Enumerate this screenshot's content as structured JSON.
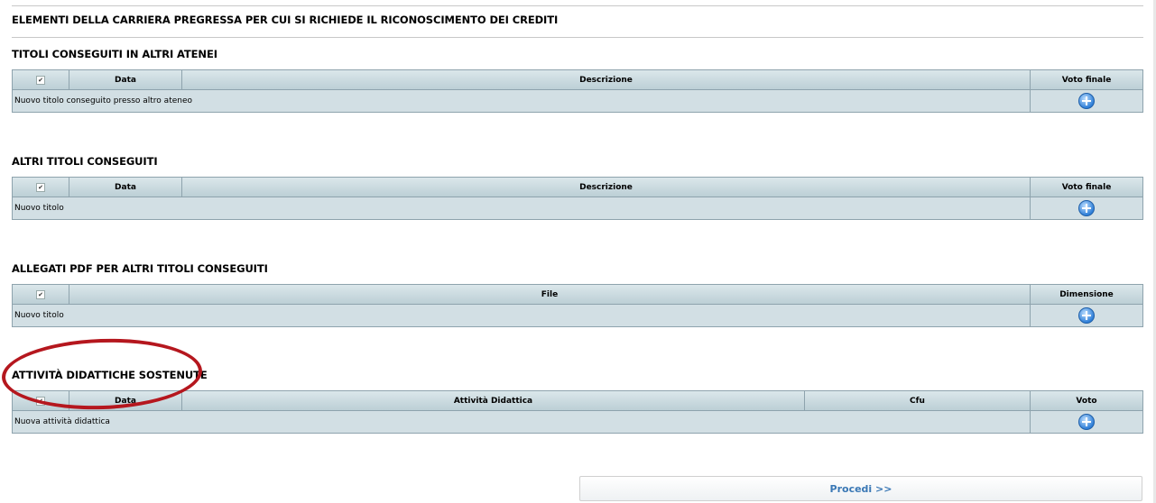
{
  "page_title": "ELEMENTI DELLA CARRIERA PREGRESSA PER CUI SI RICHIEDE IL RICONOSCIMENTO DEI CREDITI",
  "sections": [
    {
      "title": "TITOLI CONSEGUITI IN ALTRI ATENEI",
      "headers": [
        "✔",
        "Data",
        "Descrizione",
        "Voto finale"
      ],
      "row_label": "Nuovo titolo conseguito presso altro ateneo"
    },
    {
      "title": "ALTRI TITOLI CONSEGUITI",
      "headers": [
        "✔",
        "Data",
        "Descrizione",
        "Voto finale"
      ],
      "row_label": "Nuovo titolo"
    },
    {
      "title": "ALLEGATI PDF PER ALTRI TITOLI CONSEGUITI",
      "headers": [
        "✔",
        "File",
        "Dimensione"
      ],
      "row_label": "Nuovo titolo"
    },
    {
      "title": "ATTIVITÀ DIDATTICHE SOSTENUTE",
      "headers": [
        "✔",
        "Data",
        "Attività Didattica",
        "Cfu",
        "Voto"
      ],
      "row_label": "Nuova attività didattica"
    }
  ],
  "icons": {
    "add": "plus-circle-icon",
    "check": "checkmark-icon"
  },
  "procedi_label": "Procedi >>",
  "colors": {
    "header_bg": "#c8d8de",
    "row_bg": "#d2dfe4",
    "highlight_oval": "#b5171e",
    "button_text": "#3a78b5"
  }
}
